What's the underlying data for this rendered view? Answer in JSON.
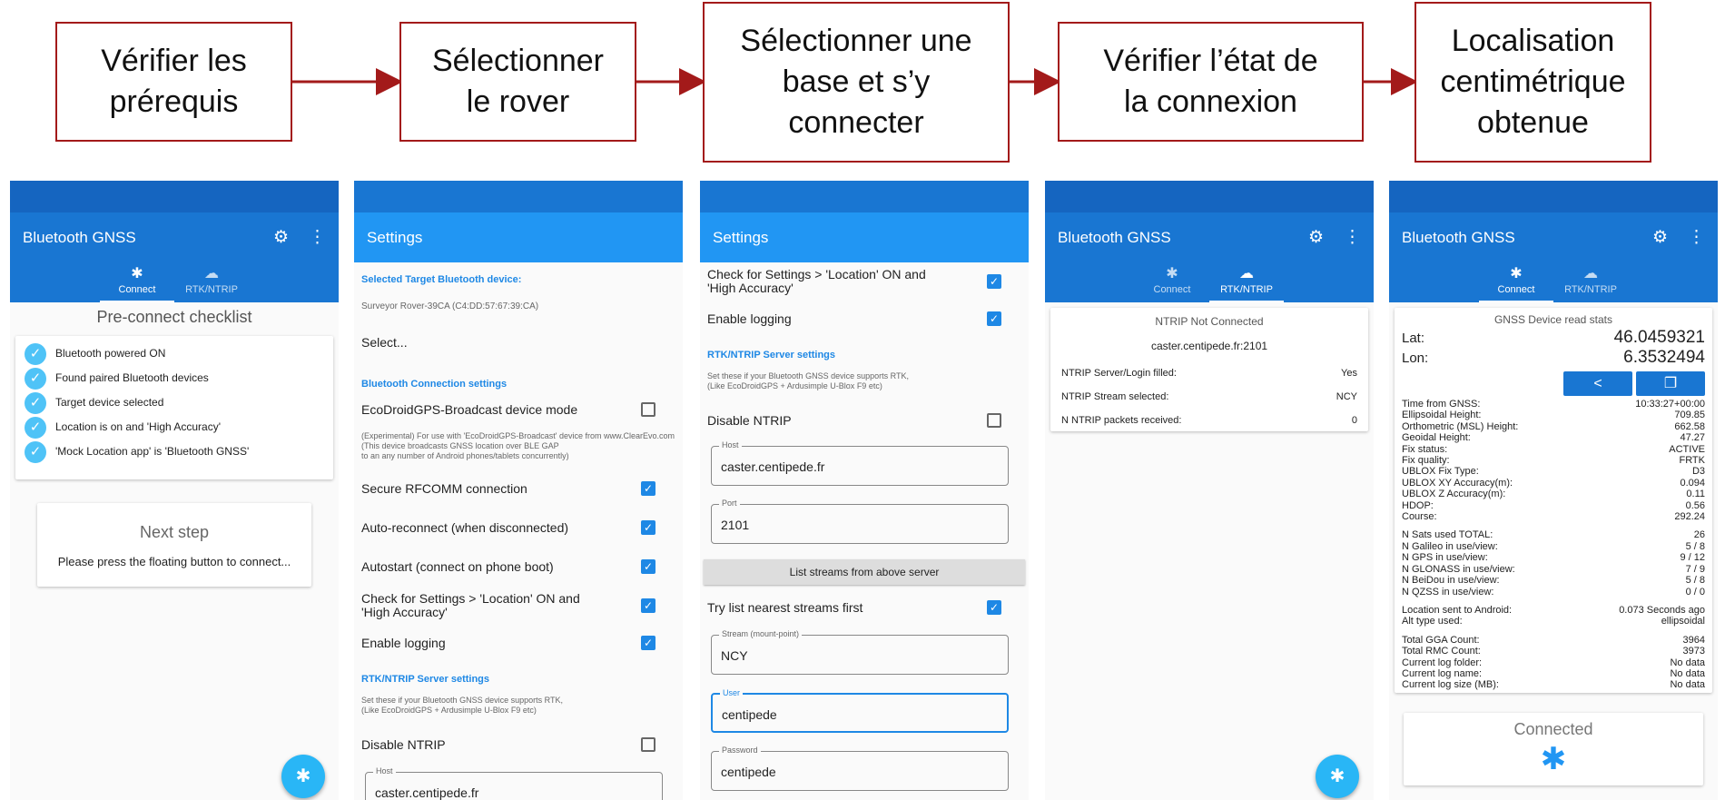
{
  "steps": [
    "Vérifier les\nprérequis",
    "Sélectionner\nle rover",
    "Sélectionner une\nbase et s’y\nconnecter",
    "Vérifier l’état de\nla connexion",
    "Localisation\ncentimétrique\nobtenue"
  ],
  "colors": {
    "arrow": "#a31a1a",
    "appbar": "#1976d2",
    "statusbar": "#1565c0",
    "accent": "#1e88e5"
  },
  "screen1": {
    "title": "Bluetooth GNSS",
    "tab_connect": "Connect",
    "tab_rtk": "RTK/NTRIP",
    "checklist_title": "Pre-connect checklist",
    "checklist": [
      "Bluetooth powered ON",
      "Found paired Bluetooth devices",
      "Target device selected",
      "Location is on and 'High Accuracy'",
      "'Mock Location app' is 'Bluetooth GNSS'"
    ],
    "next_title": "Next step",
    "next_text": "Please press the floating button to connect..."
  },
  "screen2": {
    "title": "Settings",
    "target_label": "Selected Target Bluetooth device:",
    "target_value": "Surveyor Rover-39CA (C4:DD:57:67:39:CA)",
    "select": "Select...",
    "bt_section": "Bluetooth Connection settings",
    "ecodroid": "EcoDroidGPS-Broadcast device mode",
    "ecodroid_desc": "(Experimental) For use with 'EcoDroidGPS-Broadcast' device from www.ClearEvo.com\n(This device broadcasts GNSS location over BLE GAP\n to an any number of Android phones/tablets concurrently)",
    "secure": "Secure RFCOMM connection",
    "autoreconnect": "Auto-reconnect (when disconnected)",
    "autostart": "Autostart (connect on phone boot)",
    "check_settings": "Check for Settings > 'Location' ON and 'High Accuracy'",
    "enable_logging": "Enable logging",
    "rtk_section": "RTK/NTRIP Server settings",
    "rtk_desc": "Set these if your Bluetooth GNSS device supports RTK,\n(Like EcoDroidGPS + Ardusimple U-Blox F9 etc)",
    "disable_ntrip": "Disable NTRIP",
    "host_label": "Host",
    "host_value": "caster.centipede.fr"
  },
  "screen3": {
    "title": "Settings",
    "check_settings": "Check for Settings > 'Location' ON and 'High Accuracy'",
    "enable_logging": "Enable logging",
    "rtk_section": "RTK/NTRIP Server settings",
    "rtk_desc": "Set these if your Bluetooth GNSS device supports RTK,\n(Like EcoDroidGPS + Ardusimple U-Blox F9 etc)",
    "disable_ntrip": "Disable NTRIP",
    "host_label": "Host",
    "host_value": "caster.centipede.fr",
    "port_label": "Port",
    "port_value": "2101",
    "list_button": "List streams from above server",
    "try_nearest": "Try list nearest streams first",
    "stream_label": "Stream (mount-point)",
    "stream_value": "NCY",
    "user_label": "User",
    "user_value": "centipede",
    "password_label": "Password",
    "password_value": "centipede"
  },
  "screen4": {
    "title": "Bluetooth GNSS",
    "tab_connect": "Connect",
    "tab_rtk": "RTK/NTRIP",
    "status": "NTRIP Not Connected",
    "server": "caster.centipede.fr:2101",
    "rows": [
      {
        "label": "NTRIP Server/Login filled:",
        "value": "Yes"
      },
      {
        "label": "NTRIP Stream selected:",
        "value": "NCY"
      },
      {
        "label": "N NTRIP packets received:",
        "value": "0"
      }
    ]
  },
  "screen5": {
    "title": "Bluetooth GNSS",
    "tab_connect": "Connect",
    "tab_rtk": "RTK/NTRIP",
    "stats_title": "GNSS Device read stats",
    "lat_label": "Lat:",
    "lat_value": "46.0459321",
    "lon_label": "Lon:",
    "lon_value": "6.3532494",
    "group1": [
      {
        "label": "Time from GNSS:",
        "value": "10:33:27+00:00"
      },
      {
        "label": "Ellipsoidal Height:",
        "value": "709.85"
      },
      {
        "label": "Orthometric (MSL) Height:",
        "value": "662.58"
      },
      {
        "label": "Geoidal Height:",
        "value": "47.27"
      },
      {
        "label": "Fix status:",
        "value": "ACTIVE"
      },
      {
        "label": "Fix quality:",
        "value": "FRTK"
      },
      {
        "label": "UBLOX Fix Type:",
        "value": "D3"
      },
      {
        "label": "UBLOX XY Accuracy(m):",
        "value": "0.094"
      },
      {
        "label": "UBLOX Z Accuracy(m):",
        "value": "0.11"
      },
      {
        "label": "HDOP:",
        "value": "0.56"
      },
      {
        "label": "Course:",
        "value": "292.24"
      }
    ],
    "group2": [
      {
        "label": "N Sats used TOTAL:",
        "value": "26"
      },
      {
        "label": "N Galileo in use/view:",
        "value": "5 / 8"
      },
      {
        "label": "N GPS in use/view:",
        "value": "9 / 12"
      },
      {
        "label": "N GLONASS in use/view:",
        "value": "7 / 9"
      },
      {
        "label": "N BeiDou in use/view:",
        "value": "5 / 8"
      },
      {
        "label": "N QZSS in use/view:",
        "value": "0 / 0"
      }
    ],
    "group3": [
      {
        "label": "Location sent to Android:",
        "value": "0.073 Seconds ago"
      },
      {
        "label": "Alt type used:",
        "value": "ellipsoidal"
      }
    ],
    "group4": [
      {
        "label": "Total GGA Count:",
        "value": "3964"
      },
      {
        "label": "Total RMC Count:",
        "value": "3973"
      },
      {
        "label": "Current log folder:",
        "value": "No data"
      },
      {
        "label": "Current log name:",
        "value": "No data"
      },
      {
        "label": "Current log size (MB):",
        "value": "No data"
      }
    ],
    "connected": "Connected"
  }
}
